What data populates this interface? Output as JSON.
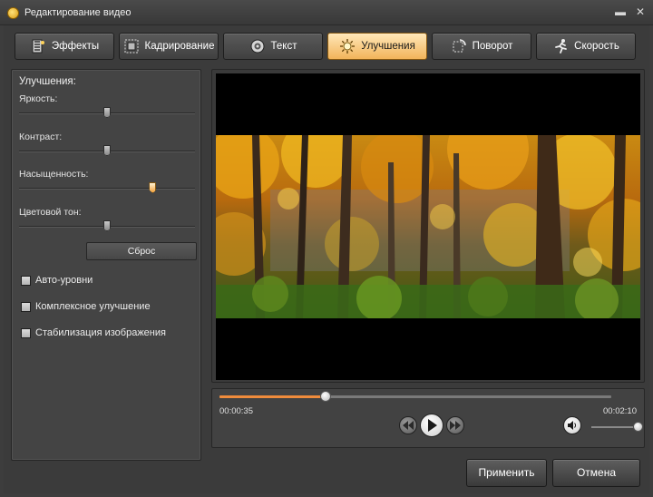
{
  "window": {
    "title": "Редактирование видео",
    "icon": "app-icon",
    "controls": {
      "minimize": "▬",
      "close": "✕"
    }
  },
  "tabs": [
    {
      "label": "Эффекты",
      "icon": "effects-icon",
      "active": false
    },
    {
      "label": "Кадрирование",
      "icon": "crop-icon",
      "active": false
    },
    {
      "label": "Текст",
      "icon": "text-icon",
      "active": false
    },
    {
      "label": "Улучшения",
      "icon": "enhance-icon",
      "active": true
    },
    {
      "label": "Поворот",
      "icon": "rotate-icon",
      "active": false
    },
    {
      "label": "Скорость",
      "icon": "speed-icon",
      "active": false
    }
  ],
  "panel": {
    "title": "Улучшения:",
    "sliders": [
      {
        "label": "Яркость:",
        "value": 0.5
      },
      {
        "label": "Контраст:",
        "value": 0.5
      },
      {
        "label": "Насыщенность:",
        "value": 0.76
      },
      {
        "label": "Цветовой тон:",
        "value": 0.5
      }
    ],
    "reset_label": "Сброс",
    "options": [
      {
        "label": "Авто-уровни",
        "checked": false
      },
      {
        "label": "Комплексное улучшение",
        "checked": false
      },
      {
        "label": "Стабилизация изображения",
        "checked": false
      }
    ]
  },
  "player": {
    "current_time": "00:00:35",
    "total_time": "00:02:10",
    "progress": 0.27,
    "volume": 1.0
  },
  "footer": {
    "apply_label": "Применить",
    "cancel_label": "Отмена"
  },
  "colors": {
    "accent": "#f08c3c",
    "active_tab": "#f2b45a",
    "background": "#3d3d3d"
  }
}
